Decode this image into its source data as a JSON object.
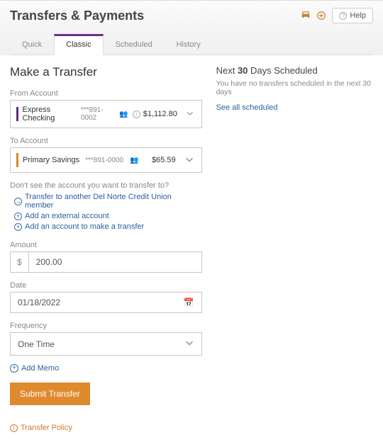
{
  "page": {
    "title": "Transfers & Payments",
    "help": "Help"
  },
  "tabs": [
    "Quick",
    "Classic",
    "Scheduled",
    "History"
  ],
  "active_tab": 1,
  "form": {
    "heading": "Make a Transfer",
    "from_label": "From Account",
    "from_account": {
      "name": "Express Checking",
      "mask": "***891-0002",
      "balance": "$1,112.80"
    },
    "to_label": "To Account",
    "to_account": {
      "name": "Primary Savings",
      "mask": "***891-0000",
      "balance": "$65.59"
    },
    "hint": "Don't see the account you want to transfer to?",
    "links": [
      "Transfer to another Del Norte Credit Union member",
      "Add an external account",
      "Add an account to make a transfer"
    ],
    "amount_label": "Amount",
    "amount_value": "200.00",
    "date_label": "Date",
    "date_value": "01/18/2022",
    "frequency_label": "Frequency",
    "frequency_value": "One Time",
    "add_memo": "Add Memo",
    "submit": "Submit Transfer",
    "policy": "Transfer Policy"
  },
  "scheduled": {
    "heading_pre": "Next ",
    "heading_bold": "30",
    "heading_post": " Days Scheduled",
    "subtext": "You have no transfers scheduled in the next 30 days",
    "see_all": "See all scheduled"
  }
}
